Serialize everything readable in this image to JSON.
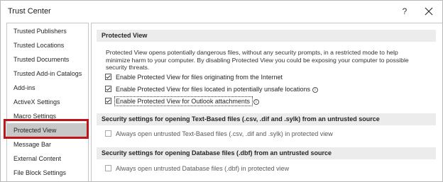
{
  "window": {
    "title": "Trust Center",
    "help_label": "?",
    "close_label": "Close"
  },
  "sidebar": {
    "items": [
      {
        "label": "Trusted Publishers"
      },
      {
        "label": "Trusted Locations"
      },
      {
        "label": "Trusted Documents"
      },
      {
        "label": "Trusted Add-in Catalogs"
      },
      {
        "label": "Add-ins"
      },
      {
        "label": "ActiveX Settings"
      },
      {
        "label": "Macro Settings"
      },
      {
        "label": "Protected View",
        "selected": true
      },
      {
        "label": "Message Bar"
      },
      {
        "label": "External Content"
      },
      {
        "label": "File Block Settings"
      }
    ]
  },
  "main": {
    "protected_view": {
      "header": "Protected View",
      "description": "Protected View opens potentially dangerous files, without any security prompts, in a restricted mode to help minimize harm to your computer. By disabling Protected View you could be exposing your computer to possible security threats.",
      "options": [
        {
          "label": "Enable Protected View for files originating from the Internet",
          "checked": true
        },
        {
          "label": "Enable Protected View for files located in potentially unsafe locations",
          "checked": true,
          "info": true
        },
        {
          "label": "Enable Protected View for Outlook attachments",
          "checked": true,
          "info": true,
          "focused": true
        }
      ]
    },
    "text_based": {
      "header": "Security settings for opening Text-Based files (.csv, .dif and .sylk) from an untrusted source",
      "option": {
        "label": "Always open untrusted Text-Based files (.csv, .dif and .sylk) in protected view",
        "checked": false
      }
    },
    "database": {
      "header": "Security settings for opening Database files (.dbf) from an untrusted source",
      "option": {
        "label": "Always open untrusted Database files (.dbf) in protected view",
        "checked": false
      }
    }
  },
  "icons": {
    "info": "info-icon",
    "close": "close-icon",
    "info_glyph": "i"
  },
  "colors": {
    "selected_bg": "#c8c8c8",
    "highlight": "#c0141b",
    "section_bg": "#ececec"
  }
}
